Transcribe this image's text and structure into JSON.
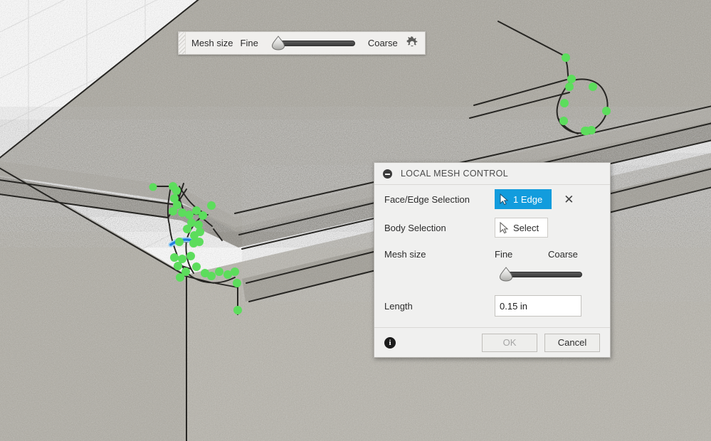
{
  "viewport": {
    "name": "cad-3d-viewport",
    "grid_color": "#e4e4e4",
    "background": "#ffffff",
    "body_fill_top": "#b3b0a7",
    "body_fill_side": "#9e9b92",
    "edge_color": "#2a2a28",
    "selection_point_color": "#5cdd5c",
    "highlight_edge_color": "#1f7fe0"
  },
  "mesh_toolbar": {
    "name": "mesh-size-toolbar",
    "label": "Mesh size",
    "fine_label": "Fine",
    "coarse_label": "Coarse",
    "slider_value_percent": 6,
    "settings_icon": "gear-icon"
  },
  "dialog": {
    "title": "LOCAL MESH CONTROL",
    "collapse_icon": "minus-circle-icon",
    "rows": {
      "face_edge": {
        "label": "Face/Edge Selection",
        "button_label": "1 Edge",
        "button_icon": "cursor-arrow-icon",
        "button_active": true,
        "clear_icon": "close-x-icon",
        "accent_color": "#129cdd"
      },
      "body": {
        "label": "Body Selection",
        "button_label": "Select",
        "button_icon": "cursor-arrow-icon",
        "button_active": false
      },
      "mesh_size": {
        "label": "Mesh size",
        "fine_label": "Fine",
        "coarse_label": "Coarse",
        "slider_value_percent": 6
      },
      "length": {
        "label": "Length",
        "value": "0.15 in"
      }
    },
    "footer": {
      "info_icon": "info-icon",
      "ok_label": "OK",
      "ok_enabled": false,
      "cancel_label": "Cancel",
      "cancel_enabled": true
    }
  }
}
